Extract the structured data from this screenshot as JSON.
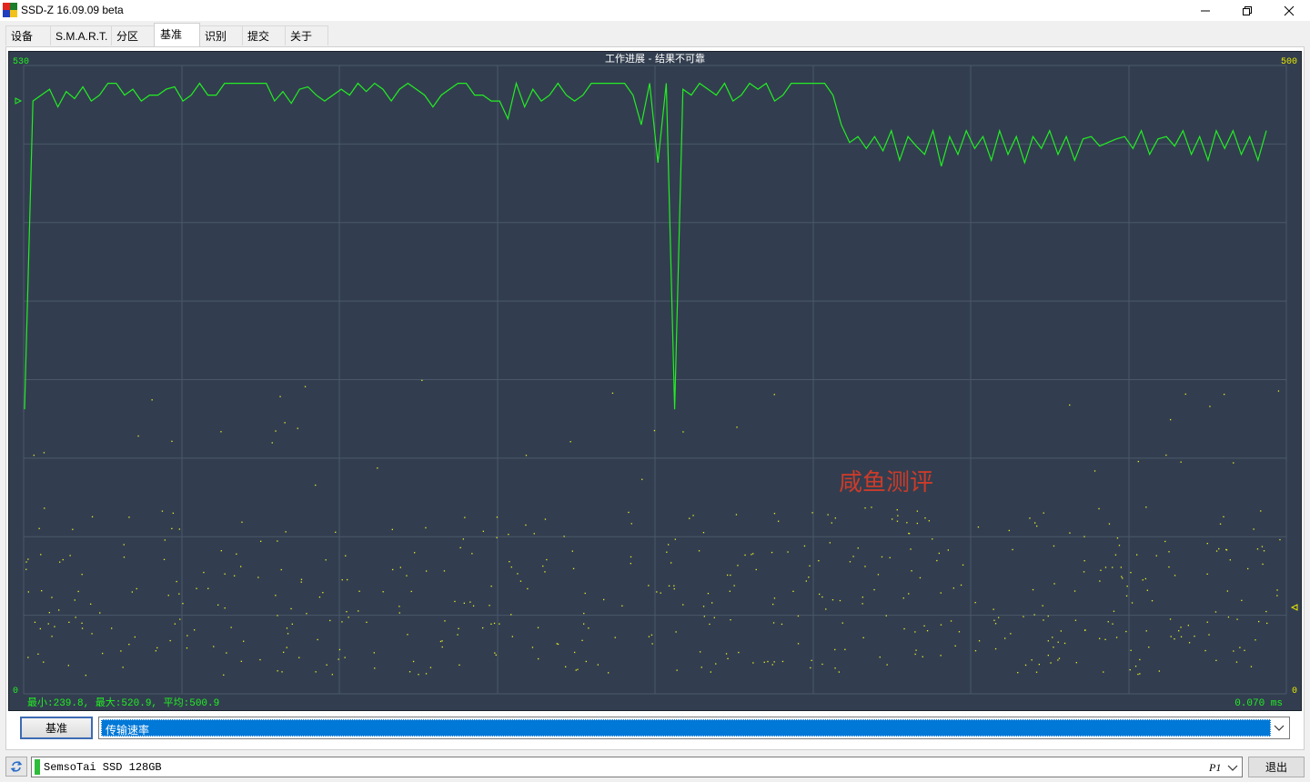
{
  "window": {
    "title": "SSD-Z 16.09.09 beta"
  },
  "tabs": [
    {
      "label": "设备",
      "active": false
    },
    {
      "label": "S.M.A.R.T.",
      "active": false
    },
    {
      "label": "分区",
      "active": false
    },
    {
      "label": "基准",
      "active": true
    },
    {
      "label": "识别",
      "active": false
    },
    {
      "label": "提交",
      "active": false
    },
    {
      "label": "关于",
      "active": false
    }
  ],
  "chart": {
    "title": "工作进展 - 结果不可靠",
    "left_max": "530",
    "left_min": "0",
    "right_max": "500",
    "right_min": "0",
    "stats": "最小:239.8, 最大:520.9, 平均:500.9",
    "latency": "0.070 ms",
    "watermark": "咸鱼测评",
    "colors": {
      "background": "#323e4f",
      "grid": "#4a5869",
      "line": "#22ee22",
      "points": "#e8ee22",
      "label": "#22ee22",
      "right_label": "#e8e800",
      "watermark": "#cc3b2a"
    }
  },
  "chart_data": {
    "type": "line",
    "ylim": [
      0,
      530
    ],
    "series_values_rule": "transfer rate samples, MB/s",
    "series": [
      {
        "values": [
          240,
          500,
          505,
          510,
          495,
          508,
          502,
          512,
          500,
          505,
          515,
          515,
          505,
          510,
          500,
          505,
          505,
          510,
          512,
          500,
          505,
          515,
          505,
          505,
          515,
          515,
          515,
          515,
          515,
          515,
          500,
          508,
          498,
          510,
          512,
          505,
          500,
          505,
          510,
          505,
          515,
          508,
          515,
          510,
          500,
          510,
          515,
          510,
          505,
          495,
          505,
          510,
          515,
          515,
          505,
          505,
          500,
          500,
          485,
          515,
          495,
          510,
          500,
          505,
          515,
          505,
          500,
          505,
          515,
          515,
          515,
          515,
          515,
          505,
          480,
          515,
          448,
          515,
          240,
          510,
          505,
          515,
          510,
          505,
          515,
          500,
          505,
          515,
          510,
          515,
          500,
          505,
          515,
          515,
          515,
          515,
          515,
          505,
          480,
          465,
          470,
          460,
          470,
          458,
          475,
          450,
          470,
          462,
          455,
          475,
          445,
          470,
          455,
          475,
          460,
          470,
          450,
          475,
          455,
          470,
          448,
          470,
          460,
          475,
          455,
          470,
          450,
          468,
          470,
          462,
          465,
          468,
          470,
          460,
          475,
          455,
          468,
          470,
          462,
          475,
          455,
          470,
          450,
          475,
          460,
          475,
          455,
          470,
          450,
          475
        ]
      }
    ]
  },
  "controls": {
    "bench_button": "基准",
    "mode_value": "传输速率"
  },
  "status": {
    "device": "SemsoTai SSD 128GB",
    "partition": "P1",
    "exit_button": "退出"
  }
}
